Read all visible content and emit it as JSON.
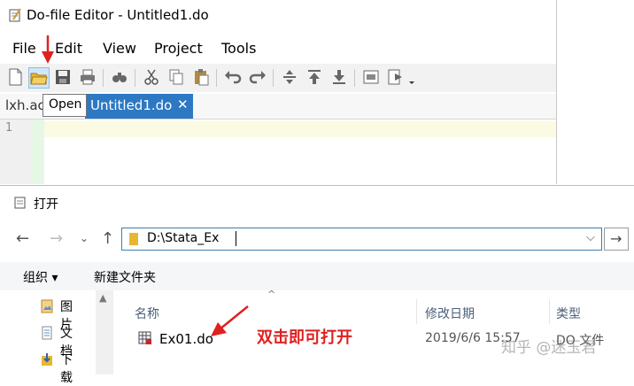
{
  "editor": {
    "title": "Do-file Editor - Untitled1.do",
    "menu": [
      "File",
      "Edit",
      "View",
      "Project",
      "Tools"
    ],
    "tabs": {
      "inactive": "lxh.ac",
      "active": "Untitled1.do",
      "close": "✕"
    },
    "tooltip": "Open",
    "line_number": "1",
    "toolbar_icons": [
      "new-file-icon",
      "open-folder-icon",
      "save-icon",
      "print-icon",
      "find-icon",
      "cut-icon",
      "copy-icon",
      "paste-icon",
      "undo-icon",
      "redo-icon",
      "indent-icon",
      "move-up-icon",
      "move-down-icon",
      "preview-icon",
      "run-icon"
    ],
    "colors": {
      "active_tab": "#2d78c3",
      "highlight": "#fbfbe3"
    }
  },
  "dialog": {
    "title": "打开",
    "address": "D:\\Stata_Ex",
    "commands": {
      "organize": "组织 ▾",
      "new_folder": "新建文件夹"
    },
    "nav_items": [
      {
        "label": "图片",
        "icon": "pictures-icon"
      },
      {
        "label": "文档",
        "icon": "documents-icon"
      },
      {
        "label": "下载",
        "icon": "downloads-icon"
      }
    ],
    "columns": {
      "name": "名称",
      "date": "修改日期",
      "type": "类型"
    },
    "file": {
      "name": "Ex01.do",
      "date": "2019/6/6 15:57",
      "type": "DO 文件"
    },
    "annotation": "双击即可打开",
    "watermark": "知乎 @迷玉君"
  }
}
